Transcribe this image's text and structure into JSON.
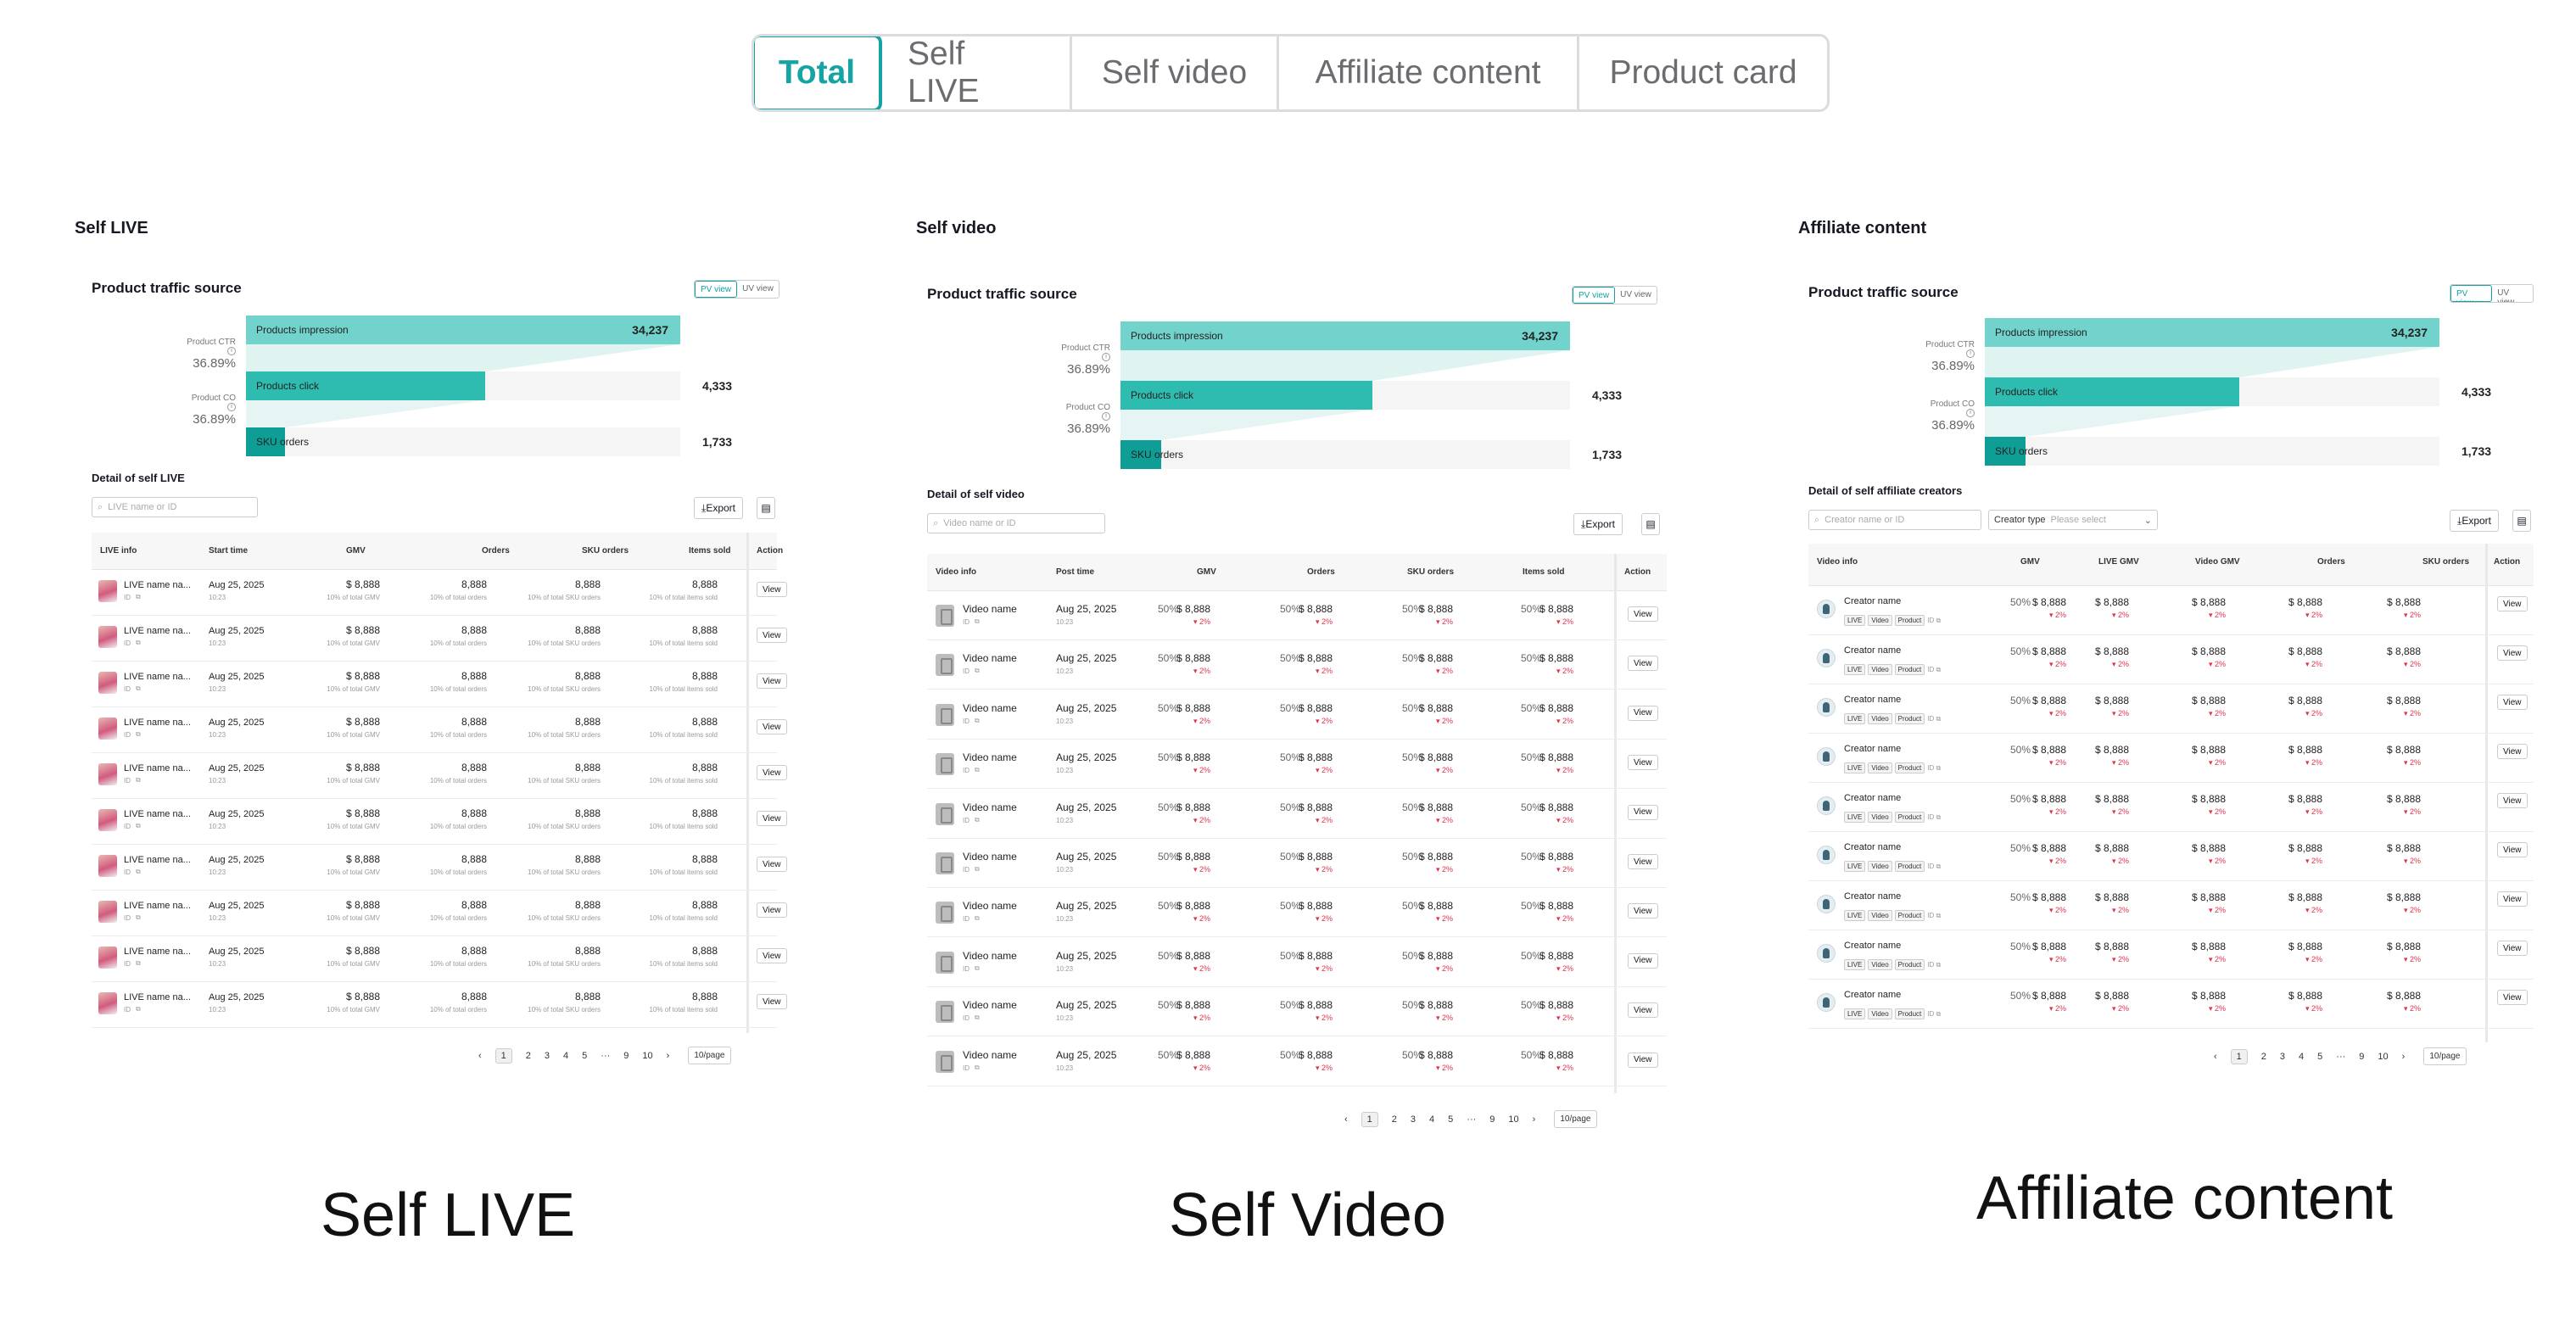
{
  "tabs": [
    "Total",
    "Self LIVE",
    "Self video",
    "Affiliate content",
    "Product card"
  ],
  "captions": {
    "live": "Self LIVE",
    "video": "Self Video",
    "affiliate": "Affiliate content"
  },
  "colors": {
    "accent": "#16a3a3",
    "bar1": "#72d3cc",
    "bar2": "#2fbcb0",
    "bar3": "#0e9e96",
    "down": "#e0334b"
  },
  "live": {
    "section_title": "Self LIVE",
    "card_title": "Product traffic source",
    "pv": "PV view",
    "uv": "UV view",
    "funnel": {
      "impression_label": "Products impression",
      "impression_val": "34,237",
      "click_label": "Products click",
      "click_val": "4,333",
      "sku_label": "SKU orders",
      "sku_val": "1,733",
      "ctr_label": "Product CTR",
      "ctr_val": "36.89%",
      "co_label": "Product CO",
      "co_val": "36.89%",
      "fractions": [
        1,
        0.55,
        0.09
      ]
    },
    "detail_title": "Detail of self LIVE",
    "search_ph": "LIVE name or ID",
    "export": "Export",
    "headers": [
      "LIVE info",
      "Start time",
      "GMV",
      "Orders",
      "SKU orders",
      "Items sold",
      "Action"
    ],
    "row": {
      "name": "LIVE name na...",
      "id": "ID",
      "date": "Aug 25, 2025",
      "time": "10:23",
      "gmv": "$ 8,888",
      "gmv_sub": "10% of total GMV",
      "orders": "8,888",
      "orders_sub": "10% of total orders",
      "sku": "8,888",
      "sku_sub": "10% of total SKU orders",
      "items": "8,888",
      "items_sub": "10% of total items sold",
      "view": "View"
    },
    "rows": 10,
    "pager": {
      "pages": [
        "1",
        "2",
        "3",
        "4",
        "5",
        "···",
        "9",
        "10"
      ],
      "per": "10/page"
    }
  },
  "video": {
    "section_title": "Self video",
    "card_title": "Product traffic source",
    "pv": "PV view",
    "uv": "UV view",
    "funnel": {
      "impression_label": "Products impression",
      "impression_val": "34,237",
      "click_label": "Products click",
      "click_val": "4,333",
      "sku_label": "SKU orders",
      "sku_val": "1,733",
      "ctr_label": "Product CTR",
      "ctr_val": "36.89%",
      "co_label": "Product CO",
      "co_val": "36.89%",
      "fractions": [
        1,
        0.56,
        0.09
      ]
    },
    "detail_title": "Detail of self video",
    "search_ph": "Video name or ID",
    "export": "Export",
    "headers": [
      "Video info",
      "Post time",
      "GMV",
      "Orders",
      "SKU orders",
      "Items sold",
      "Action"
    ],
    "row": {
      "name": "Video name",
      "id": "ID",
      "date": "Aug 25, 2025",
      "time": "10:23",
      "pct": "50%",
      "val": "$ 8,888",
      "delta": "▾ 2%",
      "view": "View"
    },
    "rows": 10,
    "pager": {
      "pages": [
        "1",
        "2",
        "3",
        "4",
        "5",
        "···",
        "9",
        "10"
      ],
      "per": "10/page"
    }
  },
  "affiliate": {
    "section_title": "Affiliate content",
    "card_title": "Product traffic source",
    "pv": "PV view",
    "uv": "UV view",
    "funnel": {
      "impression_label": "Products impression",
      "impression_val": "34,237",
      "click_label": "Products click",
      "click_val": "4,333",
      "sku_label": "SKU orders",
      "sku_val": "1,733",
      "ctr_label": "Product CTR",
      "ctr_val": "36.89%",
      "co_label": "Product CO",
      "co_val": "36.89%",
      "fractions": [
        1,
        0.56,
        0.09
      ]
    },
    "detail_title": "Detail of self affiliate creators",
    "search_ph": "Creator name or ID",
    "creator_type": "Creator type",
    "creator_ph": "Please select",
    "export": "Export",
    "headers": [
      "Video info",
      "GMV",
      "LIVE GMV",
      "Video GMV",
      "Orders",
      "SKU orders",
      "Action"
    ],
    "row": {
      "name": "Creator name",
      "badges": [
        "LIVE",
        "Video",
        "Product"
      ],
      "id": "ID",
      "pct": "50%",
      "val": "$ 8,888",
      "delta": "▾ 2%",
      "view": "View"
    },
    "rows": 9,
    "pager": {
      "pages": [
        "1",
        "2",
        "3",
        "4",
        "5",
        "···",
        "9",
        "10"
      ],
      "per": "10/page"
    }
  }
}
